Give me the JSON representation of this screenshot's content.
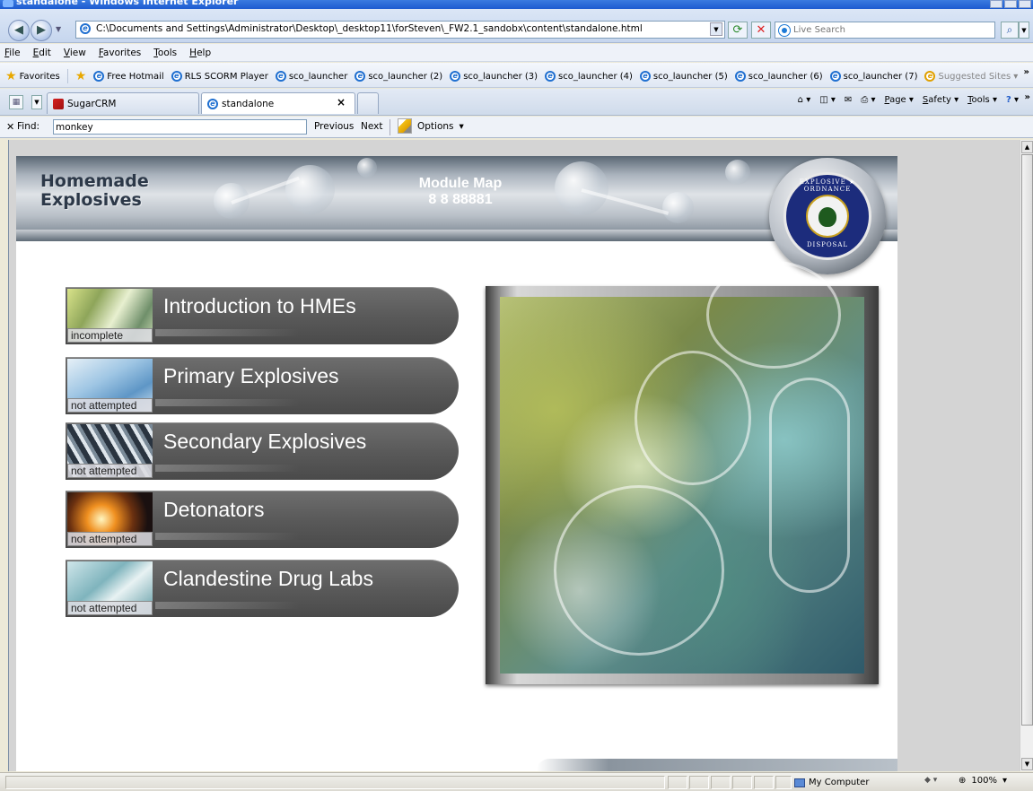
{
  "window": {
    "title": "standalone - Windows Internet Explorer"
  },
  "addressbar": {
    "url": "C:\\Documents and Settings\\Administrator\\Desktop\\_desktop11\\forSteven\\_FW2.1_sandobx\\content\\standalone.html",
    "search_placeholder": "Live Search"
  },
  "menu": [
    "File",
    "Edit",
    "View",
    "Favorites",
    "Tools",
    "Help"
  ],
  "favorites": {
    "label": "Favorites",
    "items": [
      "Free Hotmail",
      "RLS SCORM Player",
      "sco_launcher",
      "sco_launcher (2)",
      "sco_launcher (3)",
      "sco_launcher (4)",
      "sco_launcher (5)",
      "sco_launcher (6)",
      "sco_launcher (7)",
      "Suggested Sites"
    ],
    "more": "»"
  },
  "tabs": {
    "items": [
      {
        "label": "SugarCRM"
      },
      {
        "label": "standalone"
      }
    ],
    "close": "×"
  },
  "commandbar": [
    "Page",
    "Safety",
    "Tools"
  ],
  "findbar": {
    "label": "Find:",
    "value": "monkey",
    "previous": "Previous",
    "next": "Next",
    "options": "Options"
  },
  "page": {
    "app_title": "Homemade\nExplosives",
    "map_title": "Module Map",
    "map_code": "8 8 88881",
    "seal_top": "EXPLOSIVE ★ ORDNANCE",
    "seal_bottom": "DISPOSAL",
    "modules": [
      {
        "title": "Introduction to HMEs",
        "status": "incomplete"
      },
      {
        "title": "Primary Explosives",
        "status": "not attempted"
      },
      {
        "title": "Secondary Explosives",
        "status": "not attempted"
      },
      {
        "title": "Detonators",
        "status": "not attempted"
      },
      {
        "title": "Clandestine Drug Labs",
        "status": "not attempted"
      }
    ]
  },
  "statusbar": {
    "zone": "My Computer",
    "zoom": "100%"
  },
  "colors": {
    "module_bg": "#5a5a5a",
    "title_text": "#2c3848",
    "ie_blue": "#1f6fd0"
  },
  "icons": [
    "back-arrow-icon",
    "forward-arrow-icon",
    "ie-page-icon",
    "refresh-icon",
    "stop-icon",
    "live-search-icon",
    "search-go-icon",
    "favorites-star-icon",
    "add-favorites-icon",
    "quick-tabs-icon",
    "sugarcrm-icon",
    "home-icon",
    "feeds-icon",
    "mail-icon",
    "print-icon",
    "help-icon",
    "pencil-icon",
    "computer-zone-icon",
    "zoom-icon"
  ]
}
